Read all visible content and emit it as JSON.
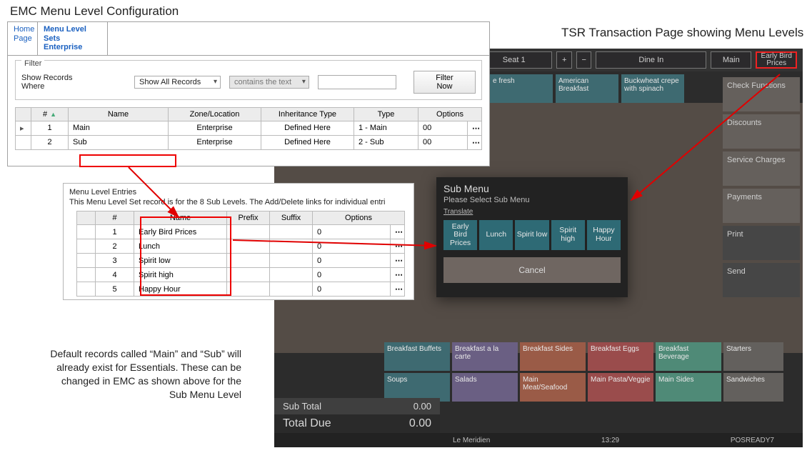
{
  "captions": {
    "leftTitle": "EMC Menu Level Configuration",
    "rightTitle": "TSR Transaction Page showing Menu Levels",
    "footnote": "Default records called “Main” and “Sub” will already exist for Essentials. These can be changed in EMC as shown above for the Sub Menu Level"
  },
  "emc": {
    "tabs": {
      "home": "Home Page",
      "mls": "Menu Level Sets",
      "mlsScope": "Enterprise"
    },
    "filter": {
      "legend": "Filter",
      "label": "Show Records Where",
      "recordsSel": "Show All Records",
      "containsSel": "contains the text",
      "searchVal": "",
      "filterNow": "Filter Now"
    },
    "cols": {
      "num": "#",
      "name": "Name",
      "zone": "Zone/Location",
      "inherit": "Inheritance Type",
      "type": "Type",
      "options": "Options"
    },
    "rows": [
      {
        "num": "1",
        "name": "Main",
        "zone": "Enterprise",
        "inherit": "Defined Here",
        "type": "1 - Main",
        "options": "00"
      },
      {
        "num": "2",
        "name": "Sub",
        "zone": "Enterprise",
        "inherit": "Defined Here",
        "type": "2 - Sub",
        "options": "00"
      }
    ]
  },
  "entries": {
    "title": "Menu Level Entries",
    "desc": "This Menu Level Set record is for the 8 Sub Levels. The Add/Delete links for individual entri",
    "cols": {
      "num": "#",
      "name": "Name",
      "prefix": "Prefix",
      "suffix": "Suffix",
      "options": "Options"
    },
    "rows": [
      {
        "num": "1",
        "name": "Early Bird Prices",
        "prefix": "",
        "suffix": "",
        "options": "0"
      },
      {
        "num": "2",
        "name": "Lunch",
        "prefix": "",
        "suffix": "",
        "options": "0"
      },
      {
        "num": "3",
        "name": "Spirit low",
        "prefix": "",
        "suffix": "",
        "options": "0"
      },
      {
        "num": "4",
        "name": "Spirit high",
        "prefix": "",
        "suffix": "",
        "options": "0"
      },
      {
        "num": "5",
        "name": "Happy Hour",
        "prefix": "",
        "suffix": "",
        "options": "0"
      }
    ]
  },
  "pos": {
    "top": {
      "seat": "Seat 1",
      "dine": "Dine In",
      "main": "Main",
      "earlyBird": "Early Bird Prices"
    },
    "menuRow": [
      "e fresh",
      "American Breakfast",
      "Buckwheat crepe with spinach"
    ],
    "right": [
      "Check Functions",
      "Discounts",
      "Service Charges",
      "Payments",
      "Print",
      "Send"
    ],
    "cats": [
      {
        "t": "Breakfast Buffets",
        "c": "c1"
      },
      {
        "t": "Breakfast a la carte",
        "c": "c2"
      },
      {
        "t": "Breakfast Sides",
        "c": "c3"
      },
      {
        "t": "Breakfast Eggs",
        "c": "c4"
      },
      {
        "t": "Breakfast Beverage",
        "c": "c5"
      },
      {
        "t": "Starters",
        "c": "c6"
      },
      {
        "t": "Soups",
        "c": "c1"
      },
      {
        "t": "Salads",
        "c": "c2"
      },
      {
        "t": "Main Meat/Seafood",
        "c": "c3"
      },
      {
        "t": "Main Pasta/Veggie",
        "c": "c4"
      },
      {
        "t": "Main Sides",
        "c": "c5"
      },
      {
        "t": "Sandwiches",
        "c": "c6"
      }
    ],
    "totals": {
      "subLabel": "Sub Total",
      "subVal": "0.00",
      "dueLabel": "Total Due",
      "dueVal": "0.00"
    },
    "status": {
      "loc": "Le Meridien",
      "time": "13:29",
      "term": "POSREADY7"
    },
    "dialog": {
      "title": "Sub Menu",
      "subtitle": "Please Select Sub Menu",
      "translate": "Translate",
      "btns": [
        "Early Bird Prices",
        "Lunch",
        "Spirit low",
        "Spirit high",
        "Happy Hour"
      ],
      "cancel": "Cancel"
    }
  }
}
